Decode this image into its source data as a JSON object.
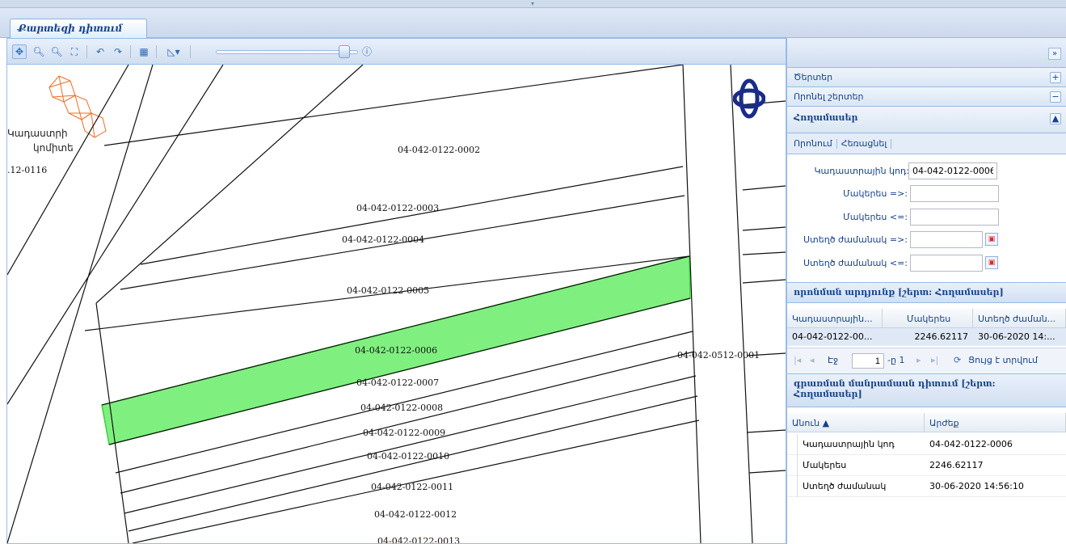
{
  "tab": {
    "label": "Քարտեզի դիտում"
  },
  "map": {
    "logo_text_line1": "Կադաստրի",
    "logo_text_line2": "կոմիտե",
    "edge_label": ".12-0116",
    "highlight_color": "#7ff07f",
    "parcels": [
      {
        "id": "label-0002",
        "text": "04-042-0122-0002"
      },
      {
        "id": "label-0003",
        "text": "04-042-0122-0003"
      },
      {
        "id": "label-0004",
        "text": "04-042-0122-0004"
      },
      {
        "id": "label-0005",
        "text": "04-042-0122-0005"
      },
      {
        "id": "label-0006",
        "text": "04-042-0122-0006"
      },
      {
        "id": "label-0007",
        "text": "04-042-0122-0007"
      },
      {
        "id": "label-0008",
        "text": "04-042-0122-0008"
      },
      {
        "id": "label-0009",
        "text": "04-042-0122-0009"
      },
      {
        "id": "label-0010",
        "text": "04-042-0122-0010"
      },
      {
        "id": "label-0011",
        "text": "04-042-0122-0011"
      },
      {
        "id": "label-0012",
        "text": "04-042-0122-0012"
      },
      {
        "id": "label-0013",
        "text": "04-042-0122-0013"
      },
      {
        "id": "label-0512",
        "text": "04-042-0512-0001"
      }
    ]
  },
  "side": {
    "accordion": [
      {
        "label": "Ծերտեր",
        "toggle": "+"
      },
      {
        "label": "Որոնել շերտեր",
        "toggle": "−"
      },
      {
        "label": "Հողամասեր",
        "toggle": "▲"
      }
    ],
    "search_toolbar": {
      "search_label": "Որոնում",
      "reset_label": "Հեռացնել"
    },
    "form": {
      "cadastral_label": "Կադաստրային կոդ:",
      "cadastral_value": "04-042-0122-0006",
      "area_min_label": "Մակերես =>:",
      "area_max_label": "Մակերես <=:",
      "created_from_label": "Ստեղծ ժամանակ =>:",
      "created_to_label": "Ստեղծ ժամանակ <=:"
    },
    "results": {
      "title": "որոնման արդյունք [շերտ: Հողամասեր]",
      "columns": [
        "Կադաստրային...",
        "Մակերես",
        "Ստեղծ ժաման..."
      ],
      "rows": [
        {
          "code": "04-042-0122-00...",
          "area": "2246.62117",
          "created": "30-06-2020 14:..."
        }
      ],
      "pager": {
        "page_label": "Էջ",
        "page_value": "1",
        "of_label": "-ը 1",
        "status": "Ցույց է տրվում"
      }
    },
    "details": {
      "title_line1": "գրառման մանրամասն դիտում [շերտ:",
      "title_line2": "Հողամասեր]",
      "columns": [
        "Անուն ▲",
        "Արժեք"
      ],
      "rows": [
        {
          "name": "Կադաստրային կոդ",
          "value": "04-042-0122-0006"
        },
        {
          "name": "Մակերես",
          "value": "2246.62117"
        },
        {
          "name": "Ստեղծ ժամանակ",
          "value": "30-06-2020 14:56:10"
        }
      ]
    }
  }
}
